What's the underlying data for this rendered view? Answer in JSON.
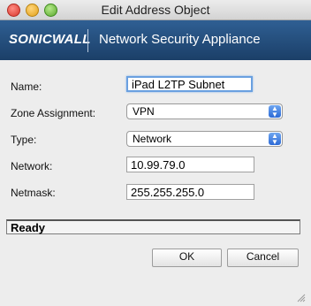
{
  "window": {
    "title": "Edit Address Object"
  },
  "banner": {
    "logo": "SONICWALL",
    "product": "Network Security Appliance"
  },
  "form": {
    "name": {
      "label": "Name:",
      "value": "iPad L2TP Subnet"
    },
    "zone": {
      "label": "Zone Assignment:",
      "value": "VPN"
    },
    "type": {
      "label": "Type:",
      "value": "Network"
    },
    "network": {
      "label": "Network:",
      "value": "10.99.79.0"
    },
    "netmask": {
      "label": "Netmask:",
      "value": "255.255.255.0"
    }
  },
  "status": {
    "text": "Ready"
  },
  "buttons": {
    "ok": "OK",
    "cancel": "Cancel"
  },
  "icons": {
    "select_arrow": "updown-arrows-icon",
    "resize": "resize-grip-icon"
  }
}
